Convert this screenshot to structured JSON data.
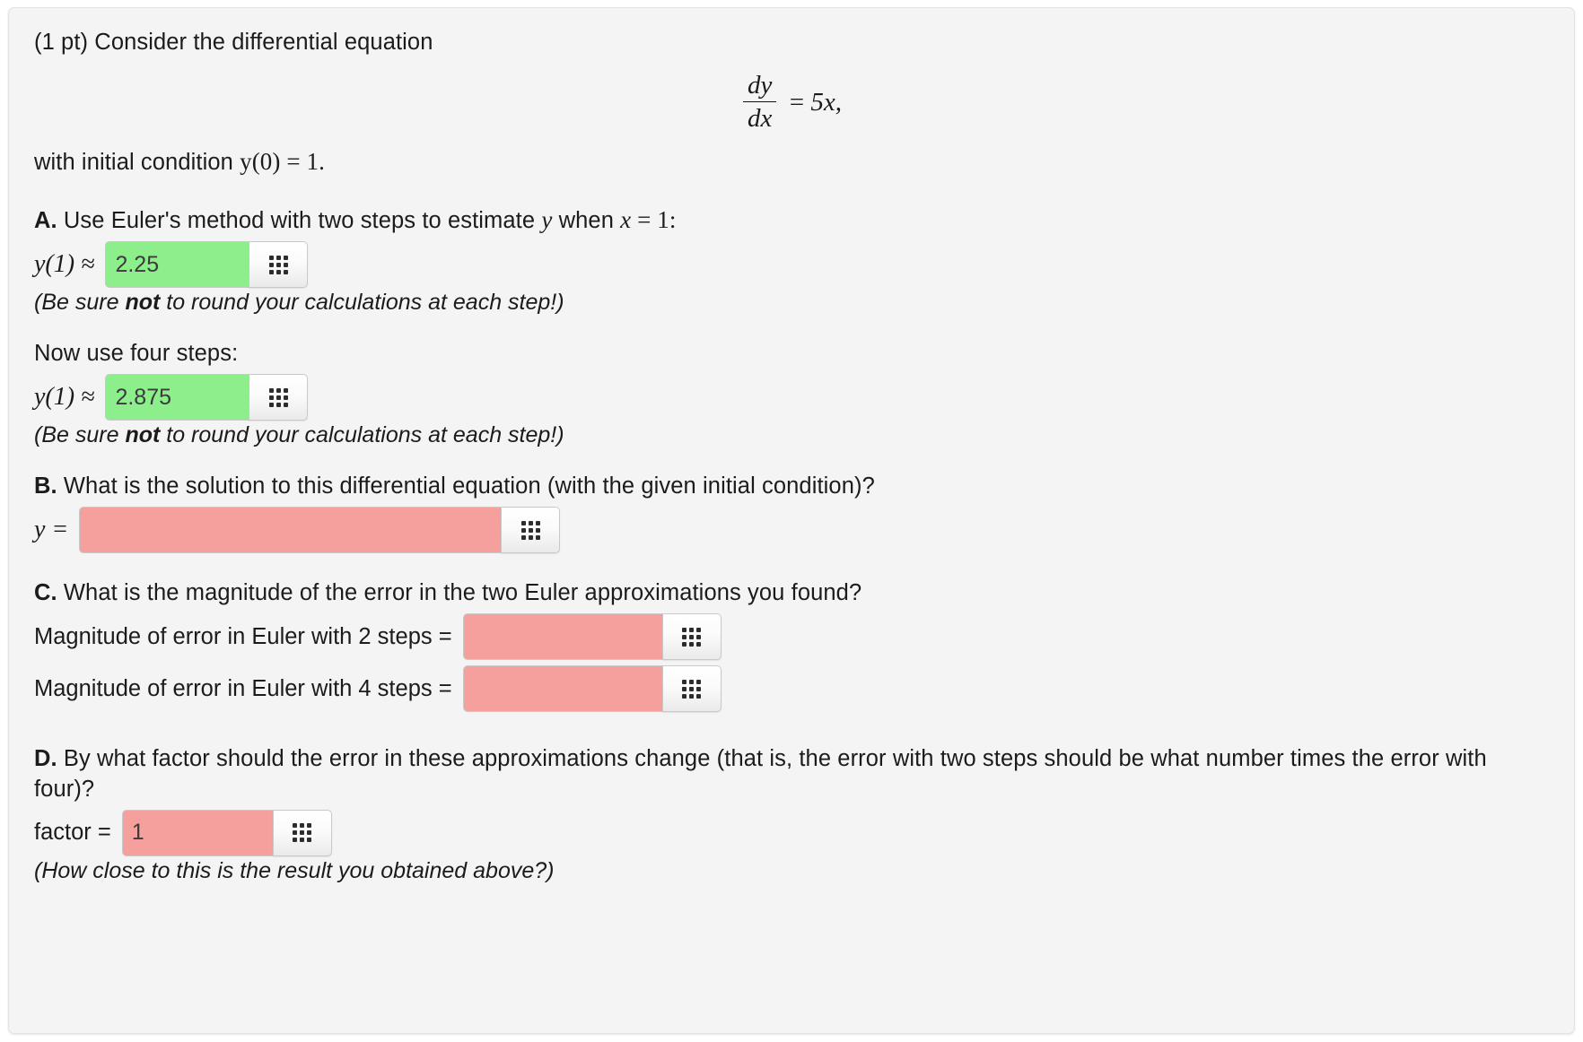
{
  "problem": {
    "intro": "(1 pt) Consider the differential equation",
    "equation": {
      "numerator": "dy",
      "denominator": "dx",
      "equals": "=",
      "rhs": "5x,"
    },
    "initial_condition_prefix": "with initial condition ",
    "initial_condition_math": "y(0) = 1."
  },
  "part_a": {
    "label": "A.",
    "text": " Use Euler's method with two steps to estimate ",
    "text_var_y": "y",
    "text_mid": " when ",
    "text_var_x": "x",
    "text_end": " = 1:",
    "answer_label": "y(1) ≈",
    "answer_value": "2.25",
    "answer_state": "correct",
    "note_pre": "(Be sure ",
    "note_bold": "not",
    "note_post": " to round your calculations at each step!)",
    "four_steps_text": "Now use four steps:",
    "answer_label_2": "y(1) ≈",
    "answer_value_2": "2.875",
    "answer_state_2": "correct",
    "note_pre_2": "(Be sure ",
    "note_bold_2": "not",
    "note_post_2": " to round your calculations at each step!)"
  },
  "part_b": {
    "label": "B.",
    "text": " What is the solution to this differential equation (with the given initial condition)?",
    "answer_label": "y =",
    "answer_value": "",
    "answer_state": "wrong"
  },
  "part_c": {
    "label": "C.",
    "text": " What is the magnitude of the error in the two Euler approximations you found?",
    "rows": [
      {
        "label": "Magnitude of error in Euler with 2 steps =",
        "value": "",
        "state": "wrong"
      },
      {
        "label": "Magnitude of error in Euler with 4 steps =",
        "value": "",
        "state": "wrong"
      }
    ]
  },
  "part_d": {
    "label": "D.",
    "text": " By what factor should the error in these approximations change (that is, the error with two steps should be what number times the error with four)?",
    "answer_label": "factor =",
    "answer_value": "1",
    "answer_state": "wrong",
    "note": "(How close to this is the result you obtained above?)"
  },
  "icons": {
    "grid_button": "grid-icon"
  },
  "colors": {
    "correct_field": "#8cef8c",
    "wrong_field": "#f5a09c",
    "card_background": "#f4f4f4",
    "page_background": "#ffffff"
  }
}
